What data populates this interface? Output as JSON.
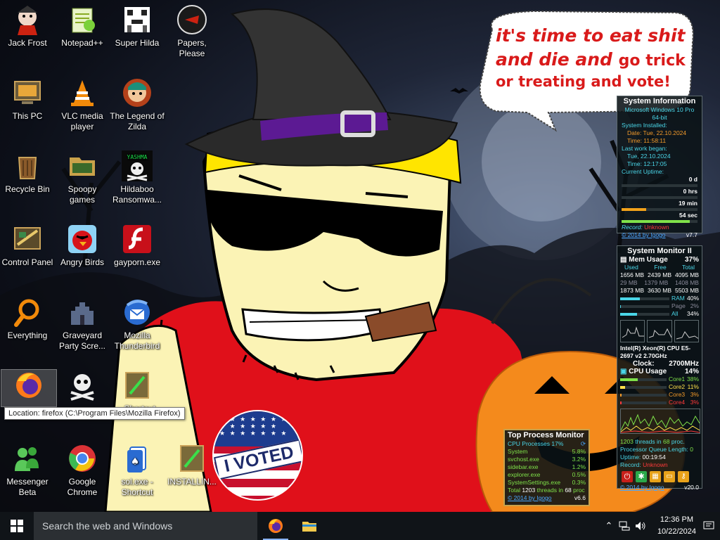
{
  "desktop_icons": [
    {
      "label": "Jack Frost"
    },
    {
      "label": "Notepad++"
    },
    {
      "label": "Super Hilda"
    },
    {
      "label": "Papers, Please"
    },
    {
      "label": "This PC"
    },
    {
      "label": "VLC media player"
    },
    {
      "label": "The Legend of Zilda"
    },
    {
      "label": "Recycle Bin"
    },
    {
      "label": "Spoopy games"
    },
    {
      "label": "Hildaboo Ransomwa..."
    },
    {
      "label": "Control Panel"
    },
    {
      "label": "Angry Birds"
    },
    {
      "label": "gayporn.exe"
    },
    {
      "label": "Everything"
    },
    {
      "label": "Graveyard Party Scre..."
    },
    {
      "label": "Mozilla Thunderbird"
    },
    {
      "label": "Firefox"
    },
    {
      "label": "skull"
    },
    {
      "label": "- Shortcut"
    },
    {
      "label": "Messenger Beta"
    },
    {
      "label": "Google Chrome"
    },
    {
      "label": "sol.exe - Shortcut"
    },
    {
      "label": "INSTALLIN..."
    }
  ],
  "tooltip": "Location: firefox (C:\\Program Files\\Mozilla Firefox)",
  "speech_bubble": {
    "line1": "it's time to eat shit",
    "line2a": "and die and ",
    "line2b": "go trick",
    "line3": "or treating and vote!"
  },
  "badge_text": "I VOTED",
  "skull_banner": "YASHMA",
  "sysinfo": {
    "title": "System Information",
    "os": "Microsoft Windows 10 Pro",
    "arch": "64-bit",
    "installed_label": "System Installed:",
    "date_label": "Date: Tue, 22.10.2024",
    "time_label": "Time: 11:58:11",
    "last_work_label": "Last work began:",
    "last_work_date": "Tue, 22.10.2024",
    "last_work_time": "Time: 12:17:05",
    "uptime_label": "Current Uptime:",
    "uptime": [
      {
        "value": "0 d",
        "fill": 0
      },
      {
        "value": "0 hrs",
        "fill": 0
      },
      {
        "value": "19 min",
        "fill": 0.32
      },
      {
        "value": "54 sec",
        "fill": 0.9
      }
    ],
    "record_label": "Record:",
    "record_value": "Unknown",
    "footer": "© 2014 by Igogo",
    "version": "v7.7"
  },
  "sysmon": {
    "title": "System Monitor II",
    "mem_label": "Mem Usage",
    "mem_pct": "37%",
    "mem_headers": [
      "Used",
      "Free",
      "Total"
    ],
    "mem_rows": [
      [
        "1656 MB",
        "2439 MB",
        "4095 MB"
      ],
      [
        "29 MB",
        "1379 MB",
        "1408 MB"
      ],
      [
        "1873 MB",
        "3630 MB",
        "5503 MB"
      ]
    ],
    "mem_bars": [
      {
        "label": "RAM",
        "pct": "40%",
        "fill": 0.4
      },
      {
        "label": "Page",
        "pct": "2%",
        "fill": 0.02
      },
      {
        "label": "All",
        "pct": "34%",
        "fill": 0.34
      }
    ],
    "cpu_name": "Intel(R) Xeon(R) CPU E5-2697 v2 2.70GHz",
    "clock_label": "Clock:",
    "clock_value": "2700MHz",
    "cpu_label": "CPU Usage",
    "cpu_pct": "14%",
    "cores": [
      {
        "label": "Core1",
        "pct": "38%",
        "fill": 0.38
      },
      {
        "label": "Core2",
        "pct": "11%",
        "fill": 0.11
      },
      {
        "label": "Core3",
        "pct": "3%",
        "fill": 0.03
      },
      {
        "label": "Core4",
        "pct": "3%",
        "fill": 0.03
      }
    ],
    "threads_text_a": "1203",
    "threads_text_b": " threads in ",
    "threads_text_c": "68",
    "threads_text_d": " proc.",
    "queue_label": "Processor Queue Length: ",
    "queue_value": "0",
    "uptime_label": "Uptime: ",
    "uptime_value": "00:19:54",
    "record_label": "Record: ",
    "record_value": "Unknown",
    "footer": "© 2014 by Igogo",
    "version": "v20.0"
  },
  "topproc": {
    "title": "Top Process Monitor",
    "header_label": "CPU Processes",
    "header_pct": "17%",
    "rows": [
      {
        "name": "System",
        "pct": "5.8%"
      },
      {
        "name": "svchost.exe",
        "pct": "3.2%"
      },
      {
        "name": "sidebar.exe",
        "pct": "1.2%"
      },
      {
        "name": "explorer.exe",
        "pct": "0.5%"
      },
      {
        "name": "SystemSettings.exe",
        "pct": "0.3%"
      }
    ],
    "total_a": "Total ",
    "total_b": "1203",
    "total_c": " threads in ",
    "total_d": "68",
    "total_e": " proc",
    "footer": "© 2014 by Igogo",
    "version": "v6.6"
  },
  "taskbar": {
    "search_placeholder": "Search the web and Windows",
    "time": "12:36 PM",
    "date": "10/22/2024"
  }
}
